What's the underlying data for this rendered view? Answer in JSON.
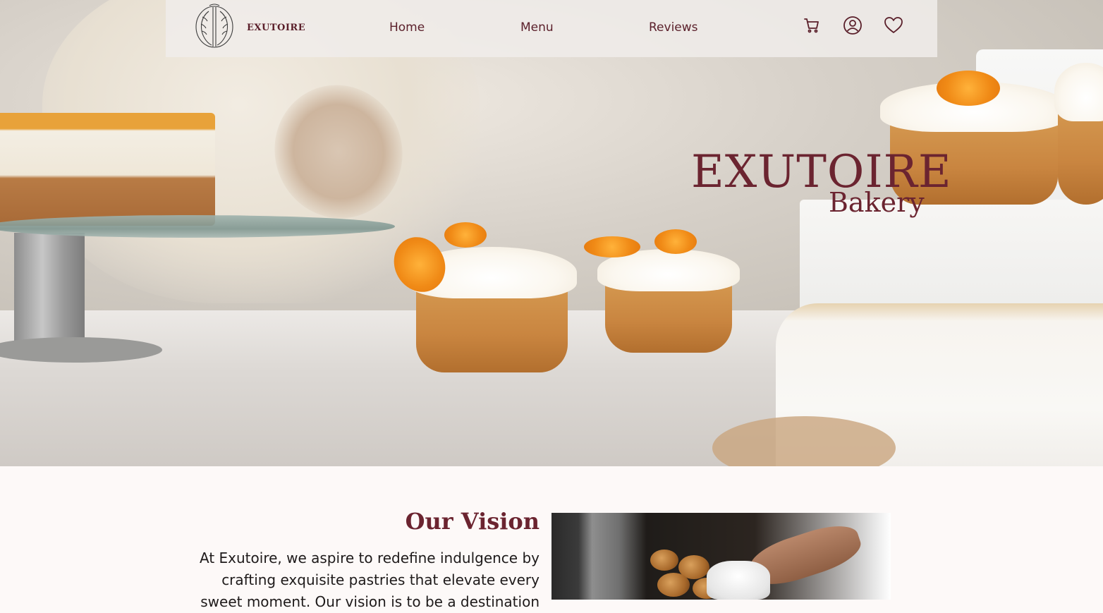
{
  "brand": {
    "name": "EXUTOIRE",
    "color": "#6b2430"
  },
  "nav": {
    "links": [
      "Home",
      "Menu",
      "Reviews"
    ],
    "icons": [
      "cart-icon",
      "account-icon",
      "heart-icon"
    ]
  },
  "hero": {
    "title": "EXUTOIRE",
    "subtitle": "Bakery"
  },
  "vision": {
    "heading": "Our Vision",
    "text": "At Exutoire, we aspire to redefine indulgence by crafting exquisite pastries that elevate every sweet moment. Our vision is to be a destination"
  }
}
